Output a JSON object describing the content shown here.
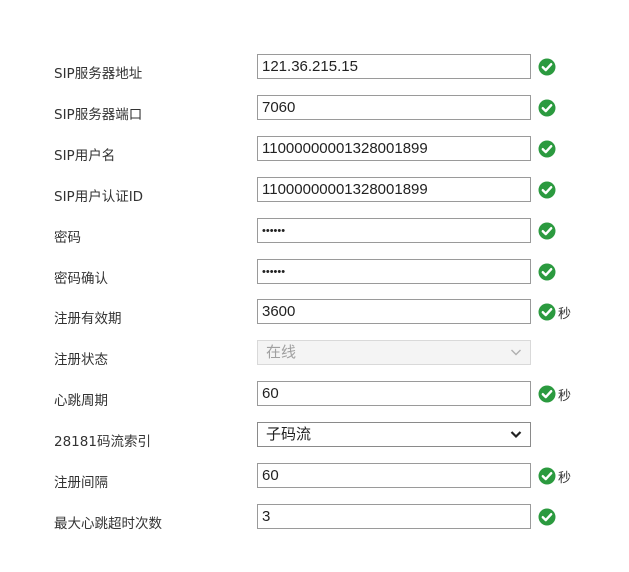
{
  "colors": {
    "success": "#2b9a3f",
    "label": "#333333",
    "border": "#9a9a9a"
  },
  "fields": [
    {
      "label": "SIP服务器地址",
      "value": "121.36.215.15",
      "type": "text",
      "valid": true,
      "unit": ""
    },
    {
      "label": "SIP服务器端口",
      "value": "7060",
      "type": "text",
      "valid": true,
      "unit": ""
    },
    {
      "label": "SIP用户名",
      "value": "11000000001328001899",
      "type": "text",
      "valid": true,
      "unit": ""
    },
    {
      "label": "SIP用户认证ID",
      "value": "11000000001328001899",
      "type": "text",
      "valid": true,
      "unit": ""
    },
    {
      "label": "密码",
      "value": "••••••",
      "type": "password",
      "valid": true,
      "unit": ""
    },
    {
      "label": "密码确认",
      "value": "••••••",
      "type": "password",
      "valid": true,
      "unit": ""
    },
    {
      "label": "注册有效期",
      "value": "3600",
      "type": "text",
      "valid": true,
      "unit": "秒"
    },
    {
      "label": "注册状态",
      "value": "在线",
      "type": "select-disabled",
      "valid": false,
      "unit": ""
    },
    {
      "label": "心跳周期",
      "value": "60",
      "type": "text",
      "valid": true,
      "unit": "秒"
    },
    {
      "label": "28181码流索引",
      "value": "子码流",
      "type": "select",
      "valid": false,
      "unit": ""
    },
    {
      "label": "注册间隔",
      "value": "60",
      "type": "text",
      "valid": true,
      "unit": "秒"
    },
    {
      "label": "最大心跳超时次数",
      "value": "3",
      "type": "text",
      "valid": true,
      "unit": ""
    }
  ],
  "icons": {
    "valid": "check-circle-icon",
    "dropdown": "chevron-down-icon"
  }
}
